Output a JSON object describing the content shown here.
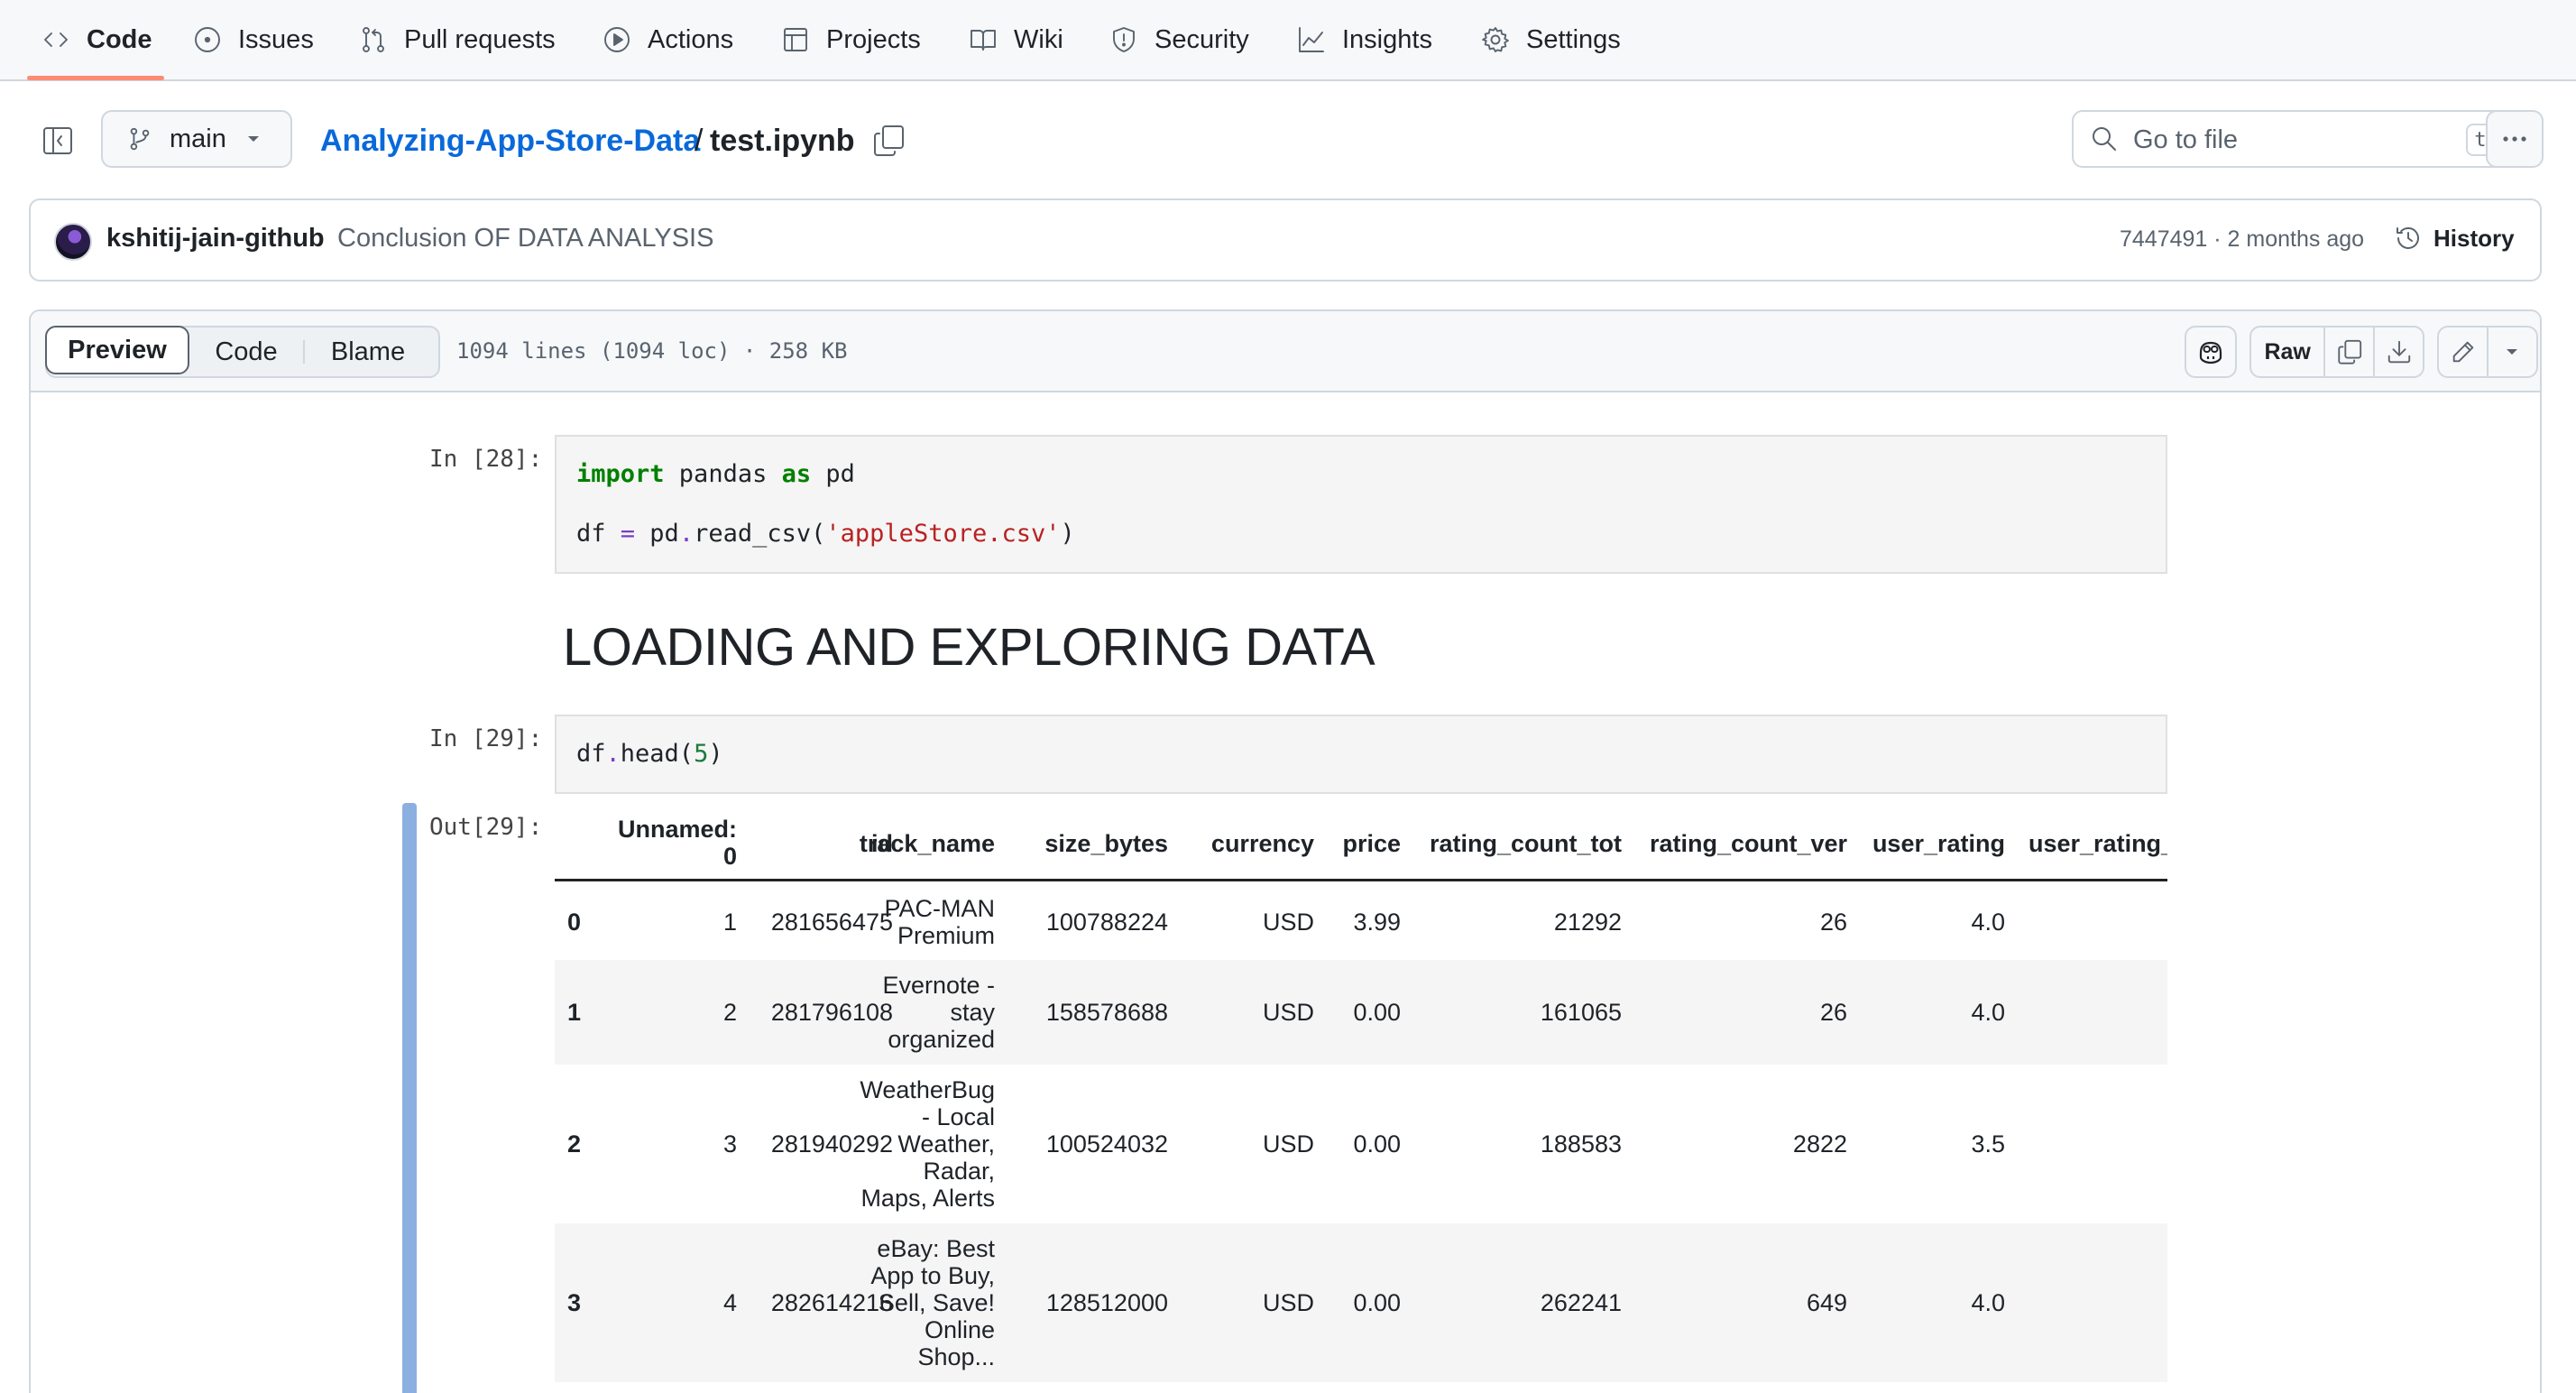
{
  "repo_nav": {
    "items": [
      {
        "label": "Code",
        "icon": "code-icon"
      },
      {
        "label": "Issues",
        "icon": "issue-icon"
      },
      {
        "label": "Pull requests",
        "icon": "pull-request-icon"
      },
      {
        "label": "Actions",
        "icon": "play-icon"
      },
      {
        "label": "Projects",
        "icon": "table-icon"
      },
      {
        "label": "Wiki",
        "icon": "book-icon"
      },
      {
        "label": "Security",
        "icon": "shield-icon"
      },
      {
        "label": "Insights",
        "icon": "graph-icon"
      },
      {
        "label": "Settings",
        "icon": "gear-icon"
      }
    ],
    "active": "Code"
  },
  "file_header": {
    "branch": "main",
    "repo_name": "Analyzing-App-Store-Data",
    "separator": "/",
    "file_name": "test.ipynb",
    "search_placeholder": "Go to file",
    "search_shortcut": "t"
  },
  "commit": {
    "author": "kshitij-jain-github",
    "message": "Conclusion OF DATA ANALYSIS",
    "meta": "7447491 · 2 months ago",
    "history_label": "History"
  },
  "file_toolbar": {
    "tabs": [
      "Preview",
      "Code",
      "Blame"
    ],
    "selected_tab": "Preview",
    "info": "1094 lines (1094 loc) · 258 KB",
    "raw_label": "Raw"
  },
  "notebook": {
    "cell1": {
      "prompt": "In [28]:",
      "line1": {
        "kw1": "import",
        "mod": " pandas ",
        "kw2": "as",
        "alias": " pd"
      },
      "line2": {
        "var": "df ",
        "eq": "=",
        "obj": " pd",
        "dot": ".",
        "fn": "read_csv(",
        "arg": "'appleStore.csv'",
        "close": ")"
      }
    },
    "heading": "LOADING AND EXPLORING DATA",
    "cell2": {
      "prompt": "In [29]:",
      "code": {
        "obj": "df",
        "dot": ".",
        "fn": "head(",
        "arg": "5",
        "close": ")"
      }
    },
    "output": {
      "prompt": "Out[29]:",
      "columns": [
        "Unnamed:\n0",
        "id",
        "track_name",
        "size_bytes",
        "currency",
        "price",
        "rating_count_tot",
        "rating_count_ver",
        "user_rating",
        "user_rating_"
      ],
      "rows": [
        {
          "index": "0",
          "values": [
            "1",
            "281656475",
            "PAC-MAN\nPremium",
            "100788224",
            "USD",
            "3.99",
            "21292",
            "26",
            "4.0"
          ]
        },
        {
          "index": "1",
          "values": [
            "2",
            "281796108",
            "Evernote -\nstay\norganized",
            "158578688",
            "USD",
            "0.00",
            "161065",
            "26",
            "4.0"
          ]
        },
        {
          "index": "2",
          "values": [
            "3",
            "281940292",
            "WeatherBug\n- Local\nWeather,\nRadar,\nMaps, Alerts",
            "100524032",
            "USD",
            "0.00",
            "188583",
            "2822",
            "3.5"
          ]
        },
        {
          "index": "3",
          "values": [
            "4",
            "282614216",
            "eBay: Best\nApp to Buy,\nSell, Save!\nOnline\nShop...",
            "128512000",
            "USD",
            "0.00",
            "262241",
            "649",
            "4.0"
          ]
        }
      ]
    }
  }
}
